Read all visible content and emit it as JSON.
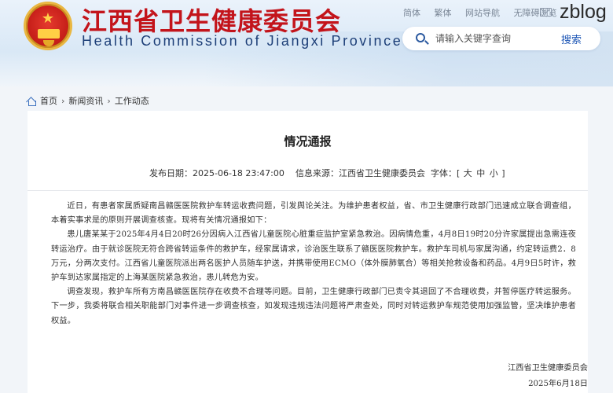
{
  "header": {
    "site_title": "江西省卫生健康委员会",
    "site_subtitle": "Health Commission of Jiangxi Province",
    "links": [
      "简体",
      "繁体",
      "网站导航",
      "无障碍浏览"
    ],
    "watermark": "zblog",
    "search": {
      "placeholder": "请输入关键字查询",
      "button_label": "搜索"
    }
  },
  "breadcrumb": {
    "items": [
      "首页",
      "新闻资讯",
      "工作动态"
    ],
    "separator": "›"
  },
  "article": {
    "title": "情况通报",
    "meta": {
      "date_label": "发布日期：",
      "date_value": "2025-06-18 23:47:00",
      "source_label": "信息来源：",
      "source_value": "江西省卫生健康委员会",
      "font_label": "字体：",
      "font_open": "[",
      "font_sizes": [
        "大",
        "中",
        "小"
      ],
      "font_close": "]"
    },
    "paragraphs": [
      "近日，有患者家属质疑南昌赣医医院救护车转运收费问题，引发舆论关注。为维护患者权益，省、市卫生健康行政部门迅速成立联合调查组，本着实事求是的原则开展调查核查。现将有关情况通报如下：",
      "患儿唐某某于2025年4月4日20时26分因病入江西省儿童医院心脏重症监护室紧急救治。因病情危重，4月8日19时20分许家属提出急需连夜转运治疗。由于就诊医院无符合跨省转运条件的救护车，经家属请求，诊治医生联系了赣医医院救护车。救护车司机与家属沟通，约定转运费2．8万元，分两次支付。江西省儿童医院派出两名医护人员随车护送，并携带使用ECMO（体外膜肺氧合）等相关抢救设备和药品。4月9日5时许，救护车到达家属指定的上海某医院紧急救治，患儿转危为安。",
      "调查发现，救护车所有方南昌赣医医院存在收费不合理等问题。目前，卫生健康行政部门已责令其退回了不合理收费，并暂停医疗转运服务。下一步，我委将联合相关职能部门对事件进一步调查核查，如发现违规违法问题将严肃查处，同时对转运救护车规范使用加强监管，坚决维护患者权益。"
    ],
    "signature_org": "江西省卫生健康委员会",
    "signature_date": "2025年6月18日"
  },
  "colors": {
    "title_red": "#c3141b",
    "subtitle_blue": "#1d3f78",
    "link_blue": "#1d56b5",
    "page_bg": "#f2f5f9"
  },
  "icons": [
    "national-emblem",
    "mail-icon",
    "search-icon",
    "home-icon"
  ]
}
